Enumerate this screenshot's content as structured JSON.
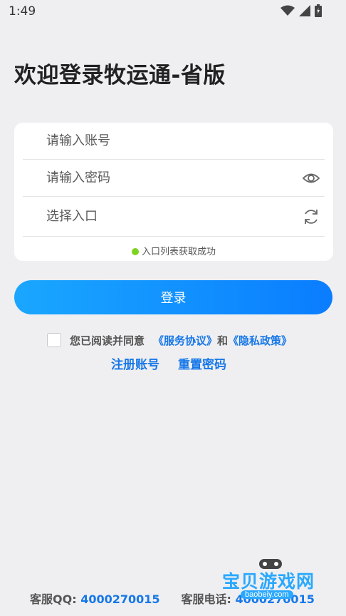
{
  "status_bar": {
    "time": "1:49"
  },
  "page": {
    "title": "欢迎登录牧运通-省版"
  },
  "form": {
    "account_placeholder": "请输入账号",
    "password_placeholder": "请输入密码",
    "entry_placeholder": "选择入口",
    "entry_status": "入口列表获取成功"
  },
  "login_button": "登录",
  "agreement": {
    "prefix": "您已阅读并同意",
    "service": "《服务协议》",
    "and": "和",
    "privacy": "《隐私政策》"
  },
  "links": {
    "register": "注册账号",
    "reset": "重置密码"
  },
  "footer": {
    "qq_label": "客服QQ:",
    "qq_number": "4000270015",
    "phone_label": "客服电话:",
    "phone_number": "4000270015"
  },
  "watermark": {
    "text": "宝贝游戏网",
    "url": "baobeiy.com"
  },
  "colors": {
    "accent": "#1677e8",
    "button_start": "#1aa7ff",
    "button_end": "#0a7dff",
    "success_dot": "#7ed321"
  },
  "icons": [
    "wifi-icon",
    "signal-icon",
    "battery-icon",
    "eye-icon",
    "refresh-icon"
  ]
}
